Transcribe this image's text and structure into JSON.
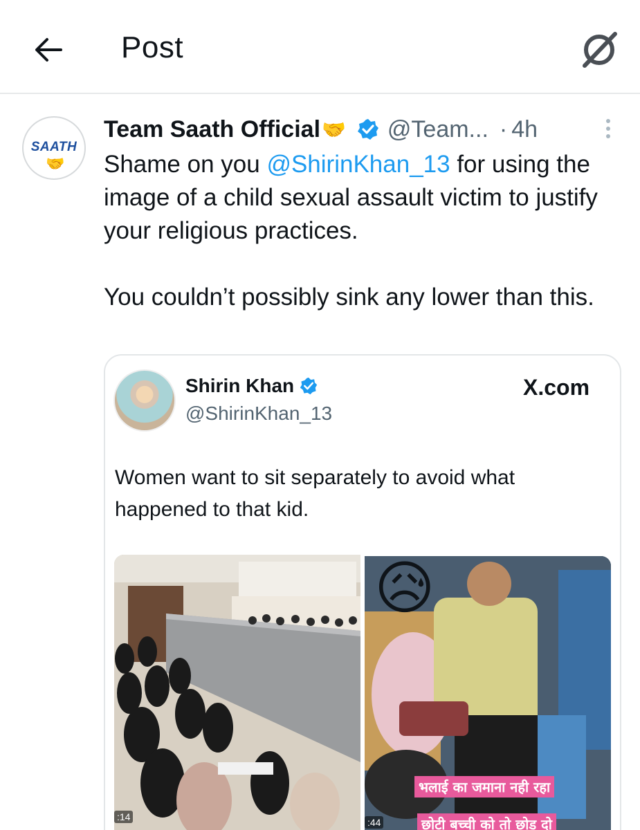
{
  "header": {
    "title": "Post",
    "back_icon": "arrow-left-icon",
    "grok_icon": "grok-icon"
  },
  "post": {
    "author_name": "Team Saath Official",
    "author_emoji": "🤝",
    "handle": "@Team...",
    "separator": "·",
    "time": "4h",
    "avatar_text": "SAATH",
    "avatar_emoji": "🤝",
    "text_before_mention": "Shame on you ",
    "mention": "@ShirinKhan_13",
    "text_after_mention": " for using the image of a child sexual assault victim to justify your religious practices.\n\nYou couldn’t possibly sink any lower than this.",
    "accent_color": "#1d9bf0"
  },
  "quote": {
    "name": "Shirin Khan",
    "handle": "@ShirinKhan_13",
    "source": "X.com",
    "text": "Women want to sit separately to avoid what happened to that kid.",
    "media": {
      "left_timestamp": ":14",
      "right_timestamp": ":44",
      "sad_emoji": "😥",
      "caption_line1": "भलाई का जमाना नही रहा",
      "caption_line2": "छोटी बच्ची को तो छोड़ दो"
    }
  }
}
